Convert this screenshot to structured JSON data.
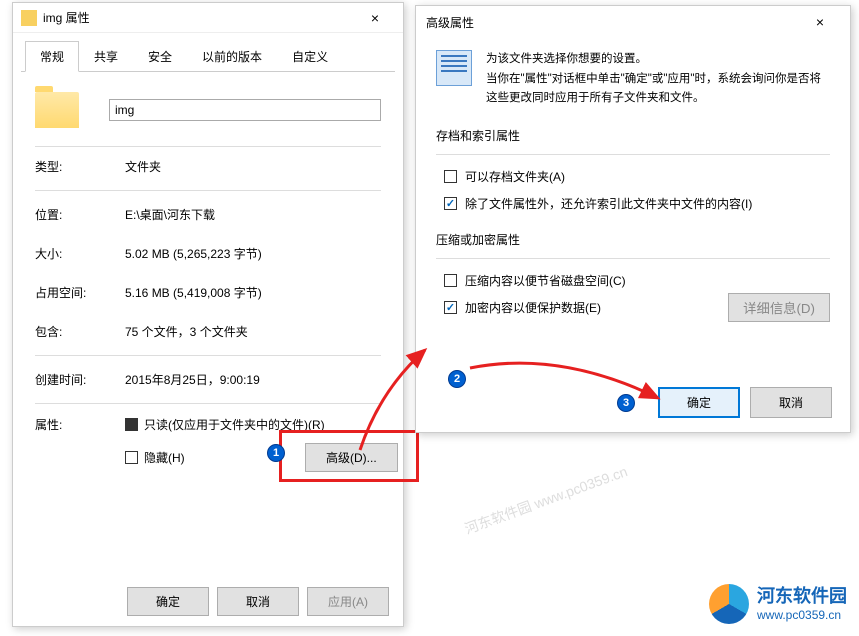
{
  "props": {
    "title": "img 属性",
    "tabs": [
      "常规",
      "共享",
      "安全",
      "以前的版本",
      "自定义"
    ],
    "name_value": "img",
    "rows": {
      "type_label": "类型:",
      "type_value": "文件夹",
      "loc_label": "位置:",
      "loc_value": "E:\\桌面\\河东下载",
      "size_label": "大小:",
      "size_value": "5.02 MB (5,265,223 字节)",
      "disk_label": "占用空间:",
      "disk_value": "5.16 MB (5,419,008 字节)",
      "contains_label": "包含:",
      "contains_value": "75 个文件，3 个文件夹",
      "created_label": "创建时间:",
      "created_value": "2015年8月25日，9:00:19",
      "attr_label": "属性:",
      "readonly": "只读(仅应用于文件夹中的文件)(R)",
      "hidden": "隐藏(H)"
    },
    "advanced_btn": "高级(D)...",
    "ok": "确定",
    "cancel": "取消",
    "apply": "应用(A)"
  },
  "adv": {
    "title": "高级属性",
    "line1": "为该文件夹选择你想要的设置。",
    "line2": "当你在\"属性\"对话框中单击\"确定\"或\"应用\"时，系统会询问你是否将这些更改同时应用于所有子文件夹和文件。",
    "group1": "存档和索引属性",
    "archive": "可以存档文件夹(A)",
    "index": "除了文件属性外，还允许索引此文件夹中文件的内容(I)",
    "group2": "压缩或加密属性",
    "compress": "压缩内容以便节省磁盘空间(C)",
    "encrypt": "加密内容以便保护数据(E)",
    "details": "详细信息(D)",
    "ok": "确定",
    "cancel": "取消"
  },
  "logo": {
    "cn": "河东软件园",
    "url": "www.pc0359.cn"
  },
  "watermarks": "河东软件园  www.pc0359.cn"
}
